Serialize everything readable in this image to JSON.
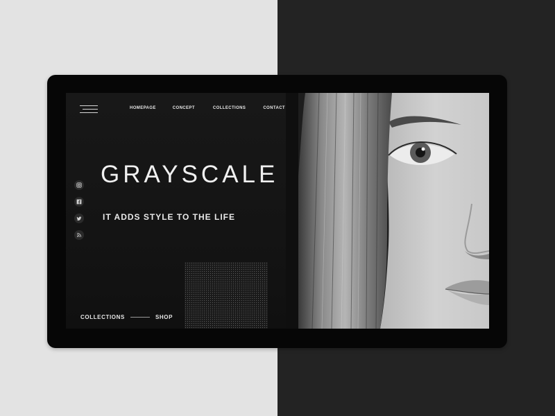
{
  "nav": {
    "items": [
      {
        "label": "HOMEPAGE"
      },
      {
        "label": "CONCEPT"
      },
      {
        "label": "COLLECTIONS"
      },
      {
        "label": "CONTACT"
      }
    ]
  },
  "hero": {
    "title": "GRAYSCALE",
    "tagline": "IT ADDS STYLE TO THE LIFE"
  },
  "social": [
    "instagram-icon",
    "facebook-icon",
    "twitter-icon",
    "rss-icon"
  ],
  "footer_links": {
    "collections": "COLLECTIONS",
    "shop": "SHOP"
  },
  "colors": {
    "background_light": "#e3e3e3",
    "background_dark": "#232323",
    "device": "#060606",
    "screen": "#151515",
    "text": "#f0f0f0"
  }
}
